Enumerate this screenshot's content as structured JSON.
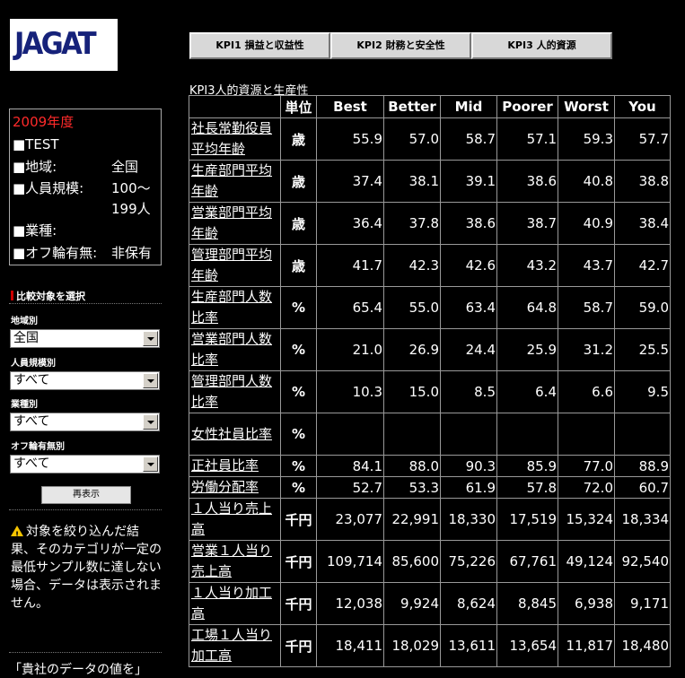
{
  "logo": "JAGAT",
  "info": {
    "year": "2009年度",
    "company": "■TEST",
    "region_key": "■地域:",
    "region_val": "全国",
    "size_key": "■人員規模:",
    "size_val": "100～",
    "size_val2": "199人",
    "industry_key": "■業種:",
    "offset_key": "■オフ輪有無:",
    "offset_val": "非保有"
  },
  "filters": {
    "heading": "比較対象を選択",
    "region_label": "地域別",
    "region_value": "全国",
    "size_label": "人員規模別",
    "size_value": "すべて",
    "industry_label": "業種別",
    "industry_value": "すべて",
    "offset_label": "オフ輪有無別",
    "offset_value": "すべて",
    "redisplay": "再表示"
  },
  "note": "対象を絞り込んだ結果、そのカテゴリが一定の最低サンプル数に達しない場合、データは表示されません。",
  "bottom_text": "「貴社のデータの値を」",
  "tabs": [
    "KPI1 損益と収益性",
    "KPI2 財務と安全性",
    "KPI3 人的資源"
  ],
  "table": {
    "caption": "KPI3人的資源と生産性",
    "headers": [
      "",
      "単位",
      "Best",
      "Better",
      "Mid",
      "Poorer",
      "Worst",
      "You"
    ],
    "rows": [
      {
        "name": "社長常勤役員平均年齢",
        "unit": "歳",
        "values": [
          "55.9",
          "57.0",
          "58.7",
          "57.1",
          "59.3",
          "57.7"
        ]
      },
      {
        "name": "生産部門平均年齢",
        "unit": "歳",
        "values": [
          "37.4",
          "38.1",
          "39.1",
          "38.6",
          "40.8",
          "38.8"
        ]
      },
      {
        "name": "営業部門平均年齢",
        "unit": "歳",
        "values": [
          "36.4",
          "37.8",
          "38.6",
          "38.7",
          "40.9",
          "38.4"
        ]
      },
      {
        "name": "管理部門平均年齢",
        "unit": "歳",
        "values": [
          "41.7",
          "42.3",
          "42.6",
          "43.2",
          "43.7",
          "42.7"
        ]
      },
      {
        "name": "生産部門人数比率",
        "unit": "%",
        "values": [
          "65.4",
          "55.0",
          "63.4",
          "64.8",
          "58.7",
          "59.0"
        ]
      },
      {
        "name": "営業部門人数比率",
        "unit": "%",
        "values": [
          "21.0",
          "26.9",
          "24.4",
          "25.9",
          "31.2",
          "25.5"
        ]
      },
      {
        "name": "管理部門人数比率",
        "unit": "%",
        "values": [
          "10.3",
          "15.0",
          "8.5",
          "6.4",
          "6.6",
          "9.5"
        ]
      },
      {
        "name": "女性社員比率",
        "unit": "%",
        "values": [
          "",
          "",
          "",
          "",
          "",
          ""
        ]
      },
      {
        "name": "正社員比率",
        "unit": "%",
        "values": [
          "84.1",
          "88.0",
          "90.3",
          "85.9",
          "77.0",
          "88.9"
        ]
      },
      {
        "name": "労働分配率",
        "unit": "%",
        "values": [
          "52.7",
          "53.3",
          "61.9",
          "57.8",
          "72.0",
          "60.7"
        ]
      },
      {
        "name": "１人当り売上高",
        "unit": "千円",
        "values": [
          "23,077",
          "22,991",
          "18,330",
          "17,519",
          "15,324",
          "18,334"
        ]
      },
      {
        "name": "営業１人当り売上高",
        "unit": "千円",
        "values": [
          "109,714",
          "85,600",
          "75,226",
          "67,761",
          "49,124",
          "92,540"
        ]
      },
      {
        "name": "１人当り加工高",
        "unit": "千円",
        "values": [
          "12,038",
          "9,924",
          "8,624",
          "8,845",
          "6,938",
          "9,171"
        ]
      },
      {
        "name": "工場１人当り加工高",
        "unit": "千円",
        "values": [
          "18,411",
          "18,029",
          "13,611",
          "13,654",
          "11,817",
          "18,480"
        ]
      }
    ]
  }
}
